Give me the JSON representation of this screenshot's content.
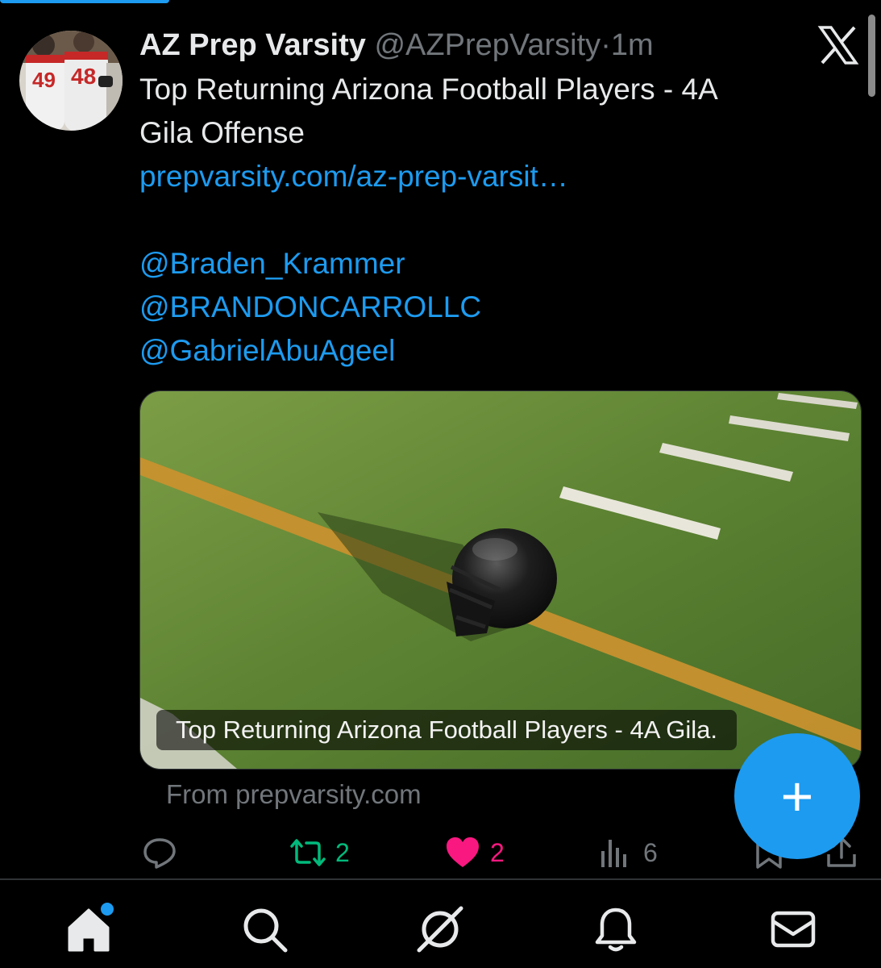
{
  "post": {
    "display_name": "AZ Prep Varsity",
    "handle": "@AZPrepVarsity",
    "separator": "·",
    "time": "1m",
    "text_line1": "Top Returning Arizona Football Players - 4A",
    "text_line2": "Gila Offense",
    "link": "prepvarsity.com/az-prep-varsit…",
    "mentions": [
      "@Braden_Krammer",
      "@BRANDONCARROLLC",
      "@GabrielAbuAgeel"
    ]
  },
  "card": {
    "caption": "Top Returning Arizona Football Players - 4A Gila.",
    "source": "From prepvarsity.com"
  },
  "avatar": {
    "jersey_left": "49",
    "jersey_right": "48"
  },
  "actions": {
    "replies": "",
    "reposts": "2",
    "likes": "2",
    "views": "6"
  },
  "fab": {
    "label": "+"
  },
  "nav": [
    "home-icon",
    "search-icon",
    "grok-icon",
    "bell-icon",
    "mail-icon"
  ],
  "colors": {
    "accent": "#1d9bf0",
    "repost": "#00ba7c",
    "like": "#f91880",
    "muted": "#71767b",
    "text": "#e7e9ea",
    "background": "#000000"
  }
}
